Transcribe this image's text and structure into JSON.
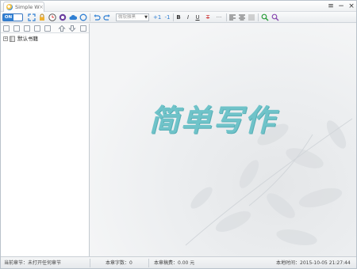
{
  "app": {
    "tab_title": "Simple W",
    "tab_close": "×"
  },
  "window_controls": {
    "menu": "≡",
    "minimize": "−",
    "close": "×"
  },
  "toolbar": {
    "toggle_on": "ON",
    "font_name": "微软雅黑",
    "font_bigger": "+1",
    "font_smaller": "-1",
    "bold": "B",
    "italic": "I",
    "underline": "U",
    "strikethrough": "T",
    "ellipsis": "···"
  },
  "tree": {
    "expand": "+",
    "item_label": "默认书籍"
  },
  "brand": {
    "text": "简单写作"
  },
  "status": {
    "current_chapter": "当前章节：未打开任何章节",
    "chapter_words": "本章字数：0",
    "chapter_royalty": "本章稿费：0.00 元",
    "local_time": "本地时间：2015-10-05 21:27:44"
  },
  "colors": {
    "accent": "#2f7fd3",
    "brand": "#6fc3c9"
  }
}
